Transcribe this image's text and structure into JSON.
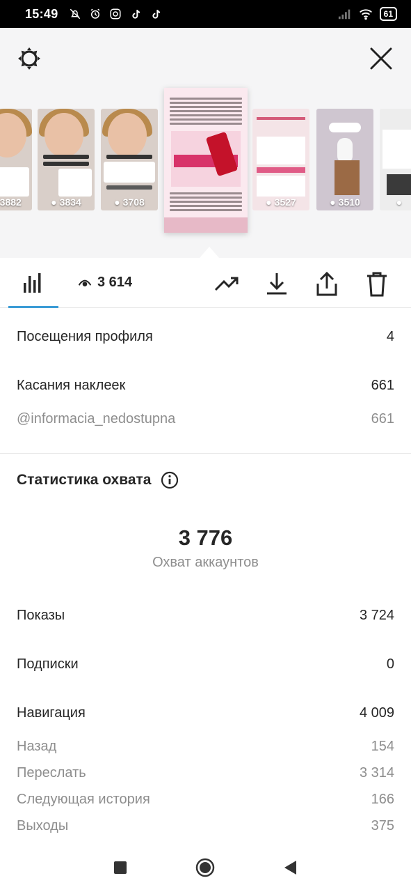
{
  "status_bar": {
    "time": "15:49",
    "battery": "61"
  },
  "stories": {
    "thumbnails": [
      {
        "views": "3882"
      },
      {
        "views": "3834"
      },
      {
        "views": "3708"
      },
      {
        "views": "3527"
      },
      {
        "views": "3510"
      },
      {
        "views": ""
      }
    ]
  },
  "toolbar": {
    "views_count": "3 614"
  },
  "interactions": {
    "profile_visits_label": "Посещения профиля",
    "profile_visits_value": "4",
    "sticker_taps_label": "Касания наклеек",
    "sticker_taps_value": "661",
    "mention_label": "@informacia_nedostupna",
    "mention_value": "661"
  },
  "reach": {
    "section_title": "Статистика охвата",
    "accounts_reached_value": "3 776",
    "accounts_reached_label": "Охват аккаунтов",
    "impressions_label": "Показы",
    "impressions_value": "3 724",
    "follows_label": "Подписки",
    "follows_value": "0",
    "navigation_label": "Навигация",
    "navigation_value": "4 009",
    "back_label": "Назад",
    "back_value": "154",
    "forward_label": "Переслать",
    "forward_value": "3 314",
    "next_story_label": "Следующая история",
    "next_story_value": "166",
    "exits_label": "Выходы",
    "exits_value": "375"
  },
  "colors": {
    "accent": "#3c9cd6",
    "text": "#262626",
    "secondary_text": "#8e8e8e"
  }
}
